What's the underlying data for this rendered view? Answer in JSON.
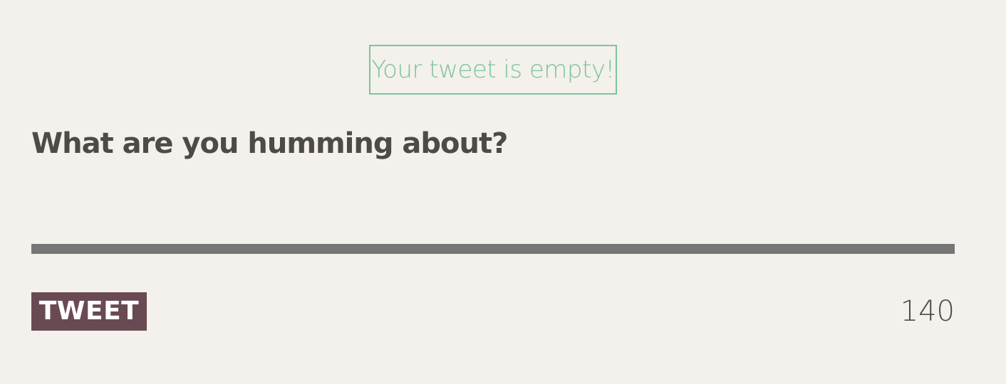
{
  "alert": {
    "message": "Your tweet is empty!",
    "color": "#7cc49a"
  },
  "composer": {
    "prompt": "What are you humming about?",
    "value": "",
    "placeholder": "",
    "tweet_label": "TWEET",
    "remaining_count": "140"
  },
  "colors": {
    "background": "#f4f0ec",
    "text": "#4e4a45",
    "button": "#6a4a52",
    "underline": "#767676"
  }
}
